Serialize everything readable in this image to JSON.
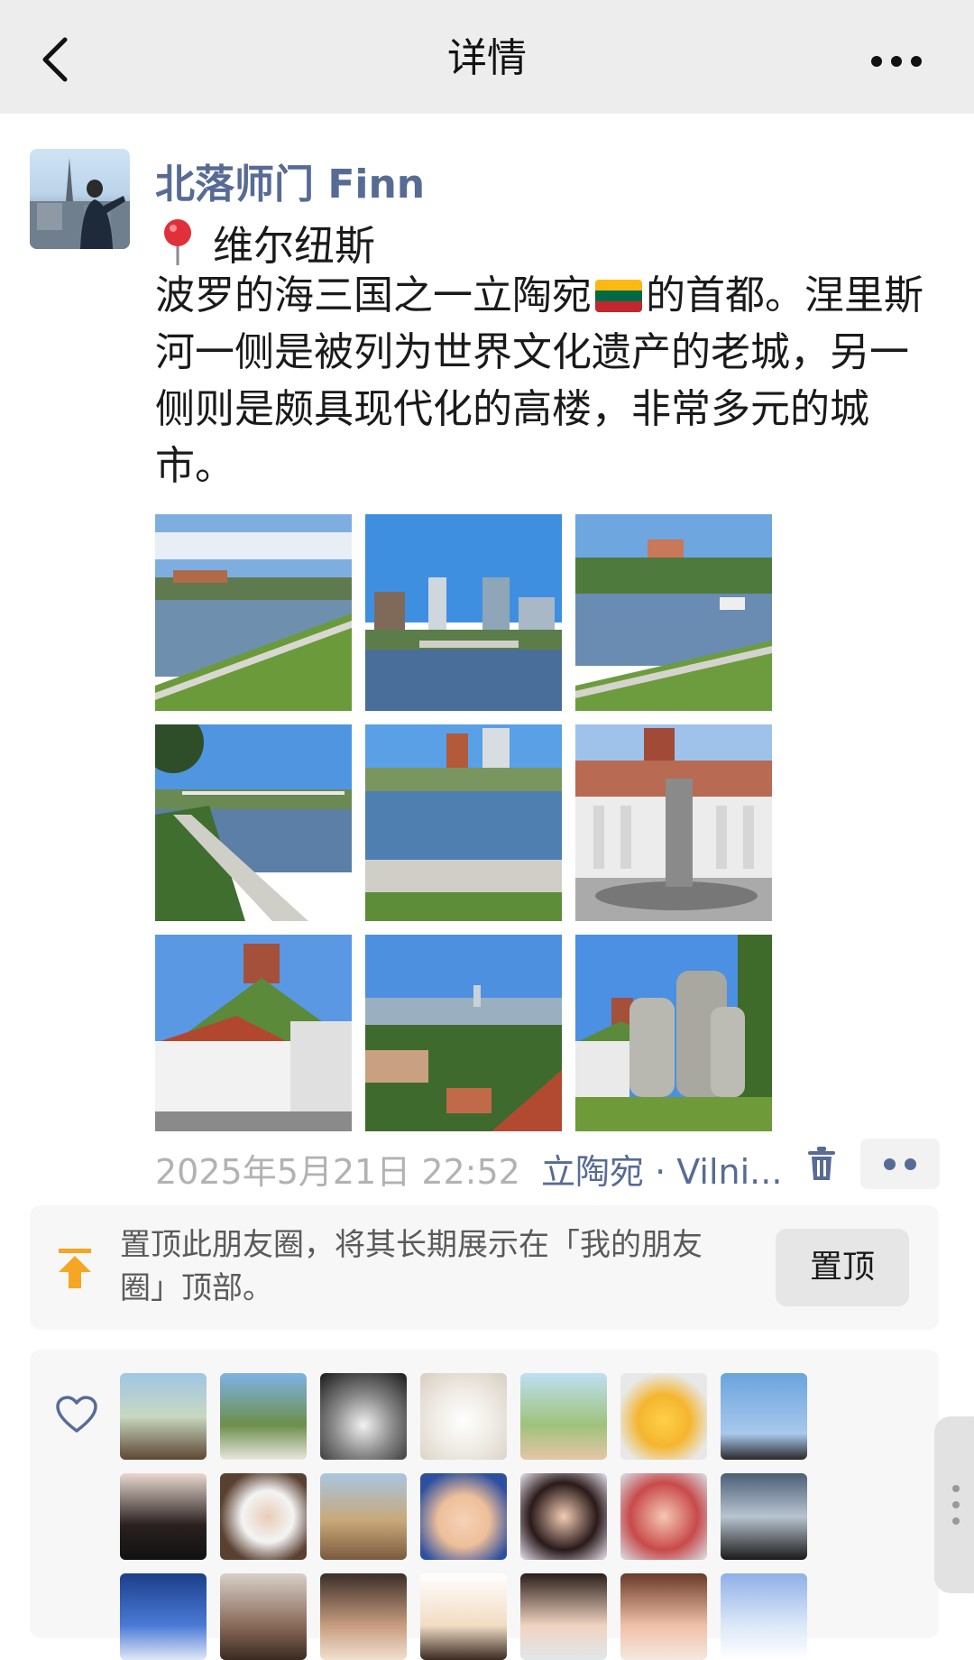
{
  "header": {
    "title": "详情"
  },
  "post": {
    "author": "北落师门 Finn",
    "location_title": "维尔纽斯",
    "text_part1": "波罗的海三国之一立陶宛",
    "text_part2": "的首都。涅里斯河一侧是被列为世界文化遗产的老城，另一侧则是颇具现代化的高楼，非常多元的城市。",
    "flag": [
      "#fdb913",
      "#006a44",
      "#c1272d"
    ],
    "photo_count": 9,
    "timestamp": "2025年5月21日 22:52",
    "location_link": "立陶宛 · Vilni..."
  },
  "pin_prompt": {
    "text": "置顶此朋友圈，将其长期展示在「我的朋友圈」顶部。",
    "button": "置顶"
  },
  "likes": {
    "visible_avatar_count": 21
  },
  "colors": {
    "link": "#576b95",
    "timestamp": "#b2b2b2",
    "pin_icon": "#f5a623"
  }
}
